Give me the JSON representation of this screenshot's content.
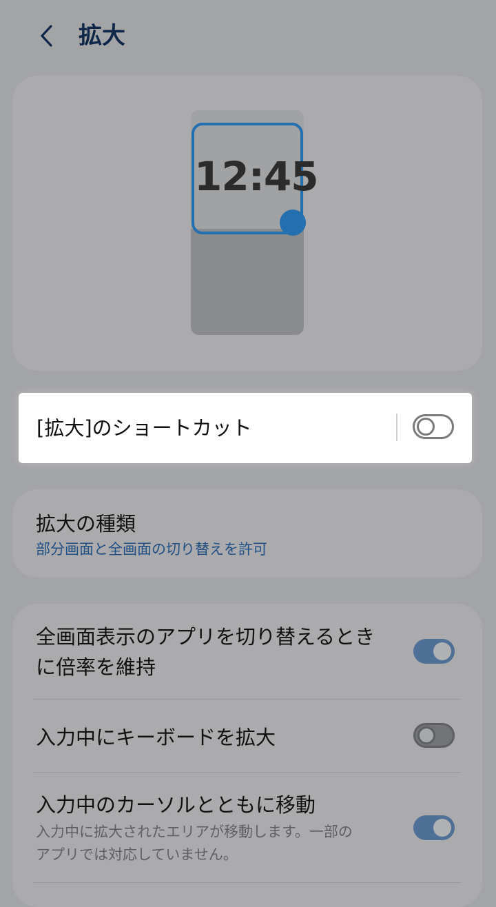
{
  "header": {
    "title": "拡大"
  },
  "preview": {
    "clock_time": "12:45"
  },
  "shortcut": {
    "label": "[拡大]のショートカット",
    "enabled": false
  },
  "magnification_type": {
    "title": "拡大の種類",
    "subtitle": "部分画面と全画面の切り替えを許可"
  },
  "settings": [
    {
      "title_line1": "全画面表示のアプリを切り替えるとき",
      "title_line2": "に倍率を維持",
      "enabled": true
    },
    {
      "title": "入力中にキーボードを拡大",
      "enabled": false
    },
    {
      "title": "入力中のカーソルとともに移動",
      "desc_line1": "入力中に拡大されたエリアが移動します。一部の",
      "desc_line2": "アプリでは対応していません。",
      "enabled": true
    }
  ],
  "colors": {
    "accent": "#236fb0",
    "subtitle_blue": "#1f4f85",
    "title_navy": "#0e2748",
    "dim_overlay_bg": "#a3a4a6",
    "card_bg": "#ababad",
    "highlight_bg": "#ffffff"
  },
  "icons": {
    "back": "chevron-left-icon"
  }
}
